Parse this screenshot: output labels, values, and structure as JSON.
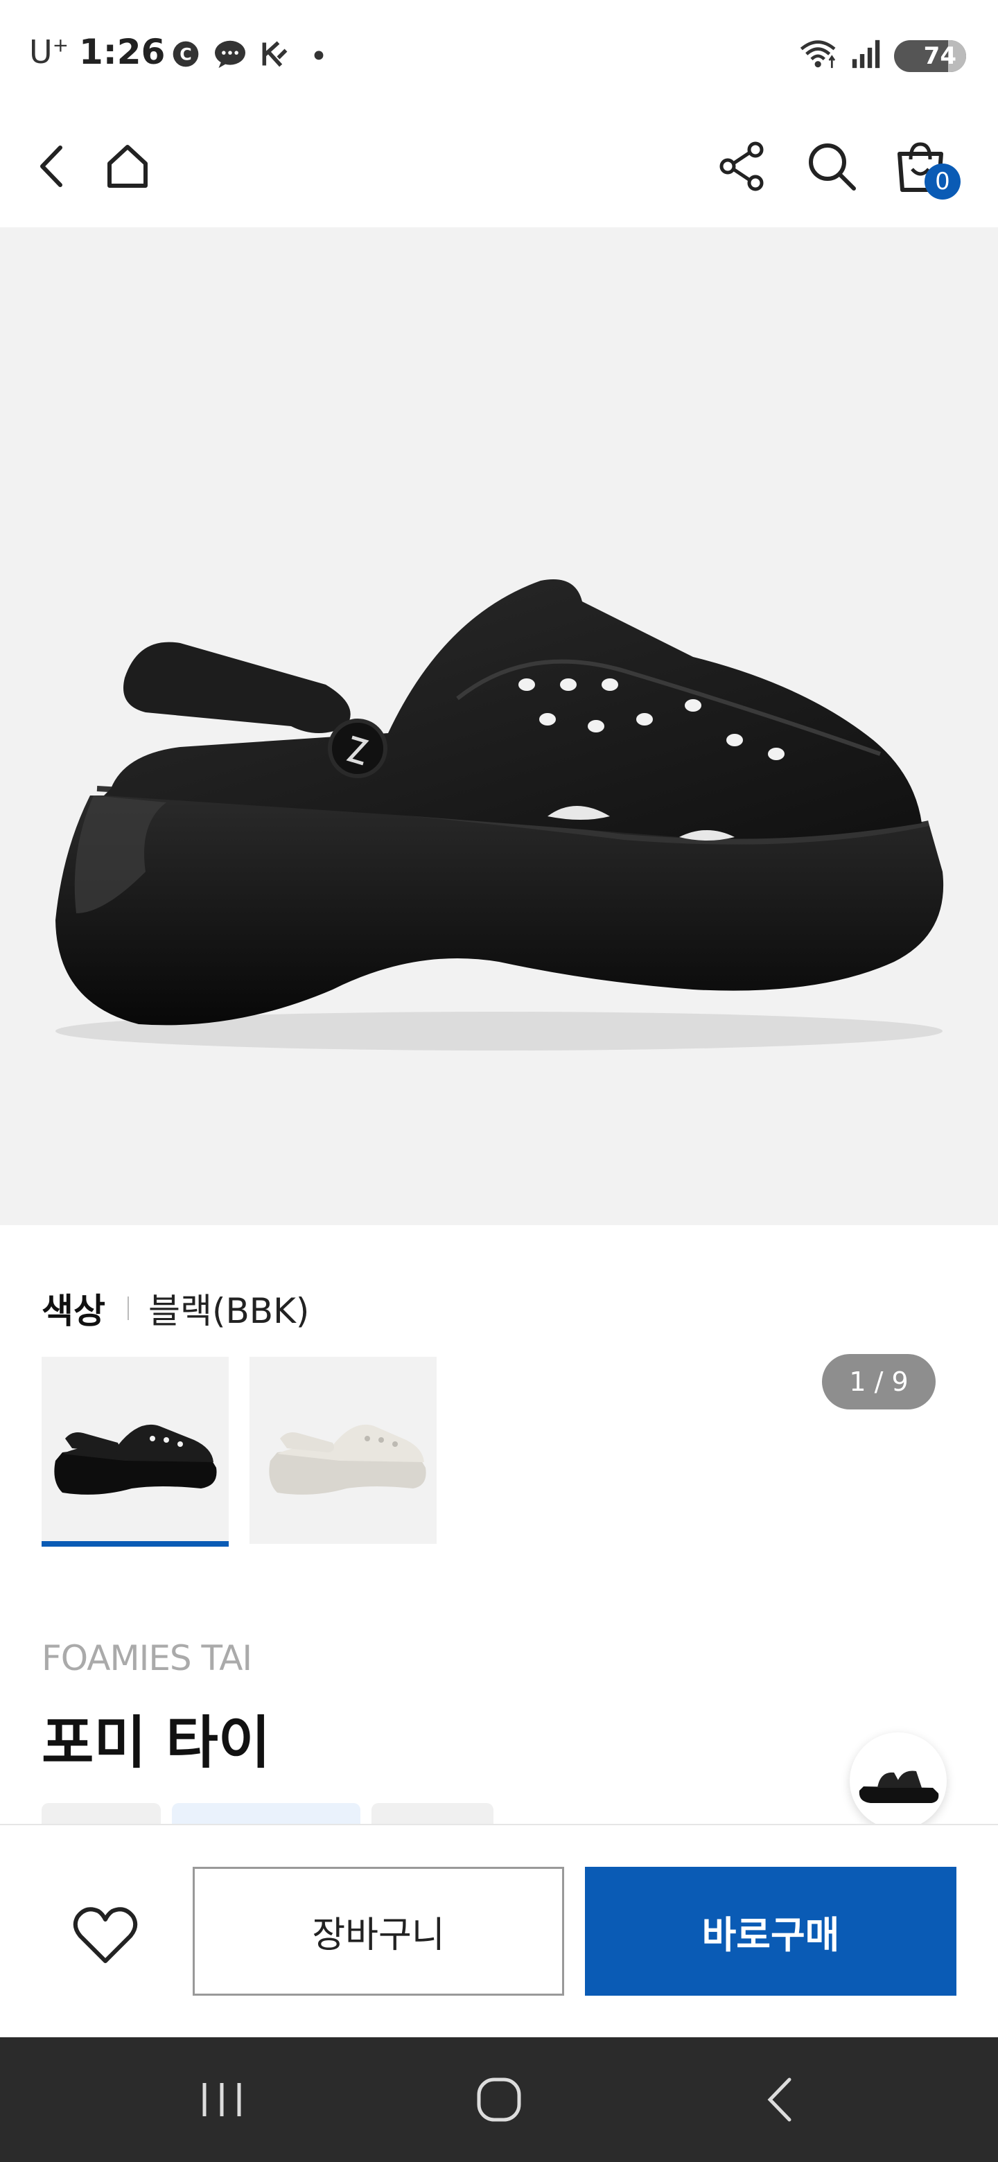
{
  "status_bar": {
    "carrier": "U",
    "carrier_sup": "+",
    "time": "1:26",
    "battery": "74",
    "icons": [
      "c-icon",
      "chat-bubble-icon",
      "k-icon",
      "dot-icon",
      "wifi-icon",
      "signal-icon"
    ]
  },
  "header": {
    "cart_count": "0",
    "icons": [
      "back-arrow-icon",
      "home-icon",
      "share-icon",
      "search-icon",
      "shopping-bag-icon"
    ]
  },
  "gallery": {
    "counter": "1 / 9",
    "background": "#f2f2f2"
  },
  "color_selector": {
    "label": "색상",
    "selected": "블랙(BBK)",
    "swatches": [
      "black-clog",
      "white-clog"
    ]
  },
  "product": {
    "name_en": "FOAMIES TAI",
    "name_ko": "포미 타이"
  },
  "actions": {
    "cart_label": "장바구니",
    "buy_label": "바로구매"
  },
  "colors": {
    "accent": "#0a5bb5",
    "nav_bar": "#2b2b2b"
  }
}
